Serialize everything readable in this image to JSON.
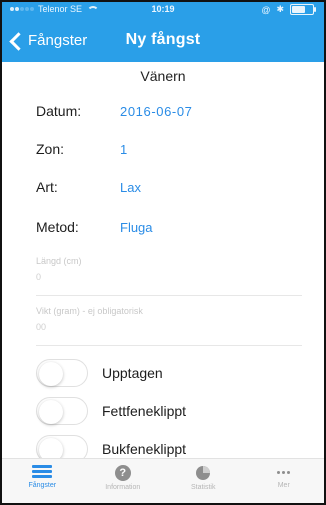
{
  "status_bar": {
    "carrier": "Telenor SE",
    "time": "10:19",
    "battery_level": 0.7
  },
  "nav": {
    "back_label": "Fångster",
    "title": "Ny fångst"
  },
  "location": "Vänern",
  "form": {
    "rows": [
      {
        "label": "Datum:",
        "value": "2016-06-07"
      },
      {
        "label": "Zon:",
        "value": "1"
      },
      {
        "label": "Art:",
        "value": "Lax"
      },
      {
        "label": "Metod:",
        "value": "Fluga"
      }
    ],
    "length_field": {
      "placeholder": "Längd (cm)",
      "value": "0"
    },
    "weight_field": {
      "placeholder": "Vikt (gram) - ej obligatorisk",
      "value": "00"
    }
  },
  "toggles": [
    {
      "label": "Upptagen",
      "on": false
    },
    {
      "label": "Fettfeneklippt",
      "on": false
    },
    {
      "label": "Bukfeneklippt",
      "on": false
    }
  ],
  "tabbar": {
    "tabs": [
      {
        "label": "Fångster",
        "icon": "list-icon",
        "active": true
      },
      {
        "label": "Information",
        "icon": "question-icon",
        "active": false
      },
      {
        "label": "Statistik",
        "icon": "pie-chart-icon",
        "active": false
      },
      {
        "label": "Mer",
        "icon": "more-icon",
        "active": false
      }
    ]
  },
  "colors": {
    "accent": "#2a9fe8",
    "value_text": "#2a8ce6"
  }
}
